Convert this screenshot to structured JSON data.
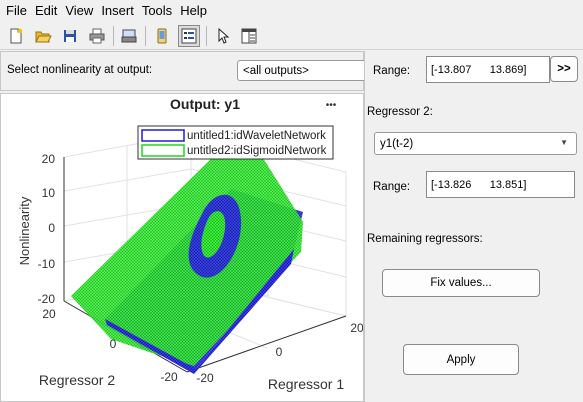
{
  "menu": [
    "File",
    "Edit",
    "View",
    "Insert",
    "Tools",
    "Help"
  ],
  "toolbar": {
    "buttons": [
      "new-file-icon",
      "open-folder-icon",
      "save-icon",
      "print-icon",
      "print-preview-icon",
      "phone-icon",
      "plot-browser-icon",
      "pointer-icon",
      "property-editor-icon"
    ]
  },
  "selector": {
    "label": "Select nonlinearity at output:",
    "value": "<all outputs>"
  },
  "plot": {
    "title": "Output: y1",
    "menu_glyph": "•••",
    "zlabel": "Nonlinearity",
    "xlabel": "Regressor 1",
    "ylabel": "Regressor 2",
    "z_ticks": [
      "20",
      "10",
      "0",
      "-10",
      "-20"
    ],
    "y_ticks": [
      "20",
      "0",
      "-20"
    ],
    "x_ticks": [
      "-20",
      "0",
      "20"
    ],
    "legend": [
      {
        "label": "untitled1:idWaveletNetwork",
        "color": "#1f1fd6"
      },
      {
        "label": "untitled2:idSigmoidNetwork",
        "color": "#22d622"
      }
    ]
  },
  "controls": {
    "range1_label": "Range:",
    "range1_value": "[-13.807      13.869]",
    "range1_button": ">>",
    "regressor2_label": "Regressor 2:",
    "regressor2_value": "y1(t-2)",
    "range2_label": "Range:",
    "range2_value": "[-13.826      13.851]",
    "remaining_label": "Remaining regressors:",
    "fix_button": "Fix values...",
    "apply_button": "Apply"
  }
}
